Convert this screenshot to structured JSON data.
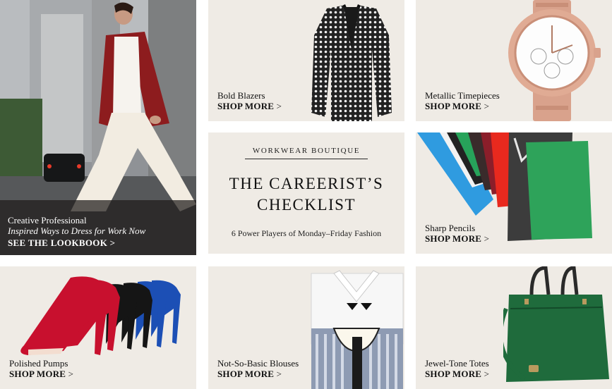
{
  "hero": {
    "title": "Creative Professional",
    "subtitle": "Inspired Ways to Dress for Work Now",
    "cta": "SEE THE LOOKBOOK",
    "chevron": ">"
  },
  "feature": {
    "kicker": "WORKWEAR BOUTIQUE",
    "headline_line1": "THE CAREERIST’S",
    "headline_line2": "CHECKLIST",
    "blurb": "6 Power Players of Monday–Friday Fashion"
  },
  "tiles": {
    "blazers": {
      "name": "Bold Blazers",
      "cta": "SHOP MORE",
      "chevron": ">"
    },
    "watches": {
      "name": "Metallic Timepieces",
      "cta": "SHOP MORE",
      "chevron": ">"
    },
    "pencils": {
      "name": "Sharp Pencils",
      "cta": "SHOP MORE",
      "chevron": ">"
    },
    "pumps": {
      "name": "Polished Pumps",
      "cta": "SHOP MORE",
      "chevron": ">"
    },
    "blouses": {
      "name": "Not-So-Basic Blouses",
      "cta": "SHOP MORE",
      "chevron": ">"
    },
    "totes": {
      "name": "Jewel-Tone Totes",
      "cta": "SHOP MORE",
      "chevron": ">"
    }
  },
  "colors": {
    "tile_bg": "#efebe5",
    "pump_red": "#c8102e",
    "pump_blue": "#1c4fb5",
    "skirt_green": "#2ea35a",
    "tote_green": "#1f6b3c",
    "watch_rose_gold": "#d9a28c"
  }
}
